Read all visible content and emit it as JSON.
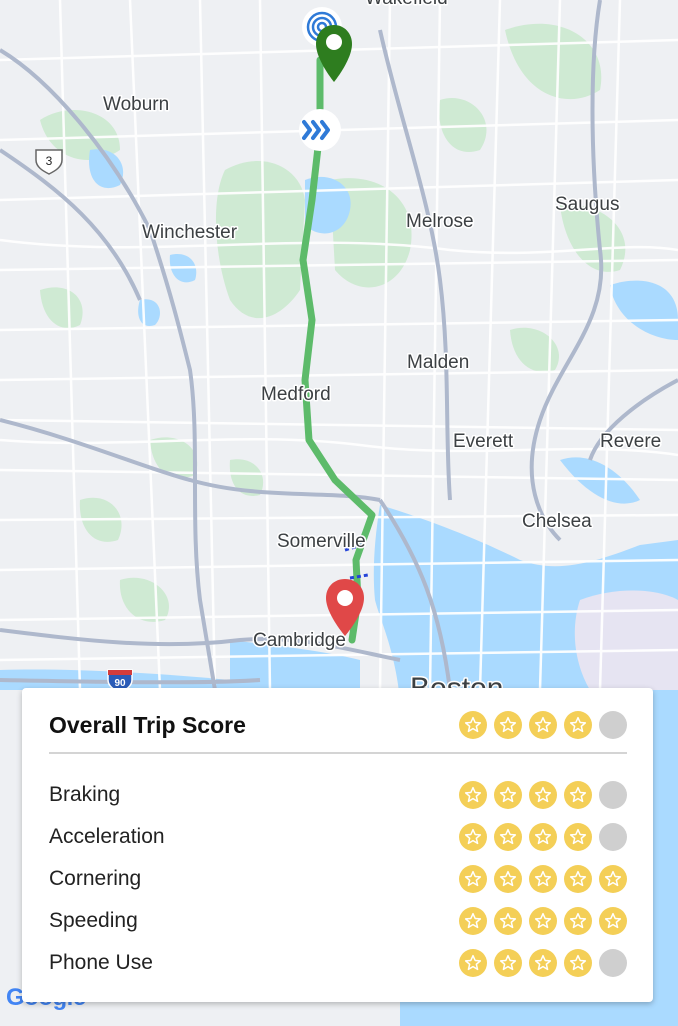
{
  "map": {
    "towns": [
      {
        "name": "Wakefield",
        "key": "wakefield"
      },
      {
        "name": "Woburn",
        "key": "woburn"
      },
      {
        "name": "Winchester",
        "key": "winchester"
      },
      {
        "name": "Melrose",
        "key": "melrose"
      },
      {
        "name": "Saugus",
        "key": "saugus"
      },
      {
        "name": "Malden",
        "key": "malden"
      },
      {
        "name": "Medford",
        "key": "medford"
      },
      {
        "name": "Everett",
        "key": "everett"
      },
      {
        "name": "Revere",
        "key": "revere"
      },
      {
        "name": "Chelsea",
        "key": "chelsea"
      },
      {
        "name": "Somerville",
        "key": "somerville"
      },
      {
        "name": "Cambridge",
        "key": "cambridge"
      },
      {
        "name": "Boston",
        "key": "boston"
      }
    ],
    "route_shields": {
      "us_route": "3",
      "interstate": "90"
    },
    "route_color": "#5dbb6a",
    "start_marker_color": "#2e7d1f",
    "end_marker_color": "#e04848",
    "attribution": "Google"
  },
  "trip_score": {
    "title": "Overall Trip Score",
    "overall_stars": 4,
    "max_stars": 5,
    "categories": [
      {
        "label": "Braking",
        "stars": 4
      },
      {
        "label": "Acceleration",
        "stars": 4
      },
      {
        "label": "Cornering",
        "stars": 5
      },
      {
        "label": "Speeding",
        "stars": 5
      },
      {
        "label": "Phone Use",
        "stars": 4
      }
    ],
    "star_on_color": "#f4cf57",
    "star_off_color": "#cfcfcf"
  }
}
